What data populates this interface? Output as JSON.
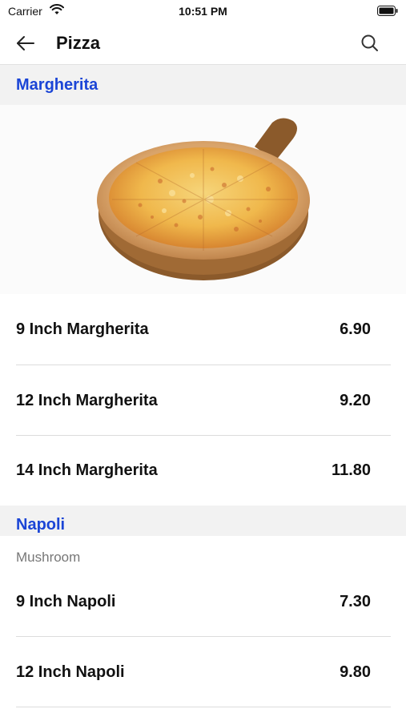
{
  "status_bar": {
    "carrier": "Carrier",
    "time": "10:51 PM",
    "icons": [
      "wifi-icon",
      "battery-icon"
    ]
  },
  "nav": {
    "title": "Pizza",
    "icons": [
      "back-arrow-icon",
      "search-icon"
    ]
  },
  "colors": {
    "section_title": "#1b45d6",
    "section_background": "#f2f2f2"
  },
  "sections": [
    {
      "title": "Margherita",
      "image": "pizza-photo",
      "items": [
        {
          "name": "9 Inch Margherita",
          "price": "6.90"
        },
        {
          "name": "12 Inch Margherita",
          "price": "9.20"
        },
        {
          "name": "14 Inch Margherita",
          "price": "11.80"
        }
      ]
    },
    {
      "title": "Napoli",
      "description": "Mushroom",
      "items": [
        {
          "name": "9 Inch Napoli",
          "price": "7.30"
        },
        {
          "name": "12 Inch Napoli",
          "price": "9.80"
        }
      ]
    }
  ]
}
